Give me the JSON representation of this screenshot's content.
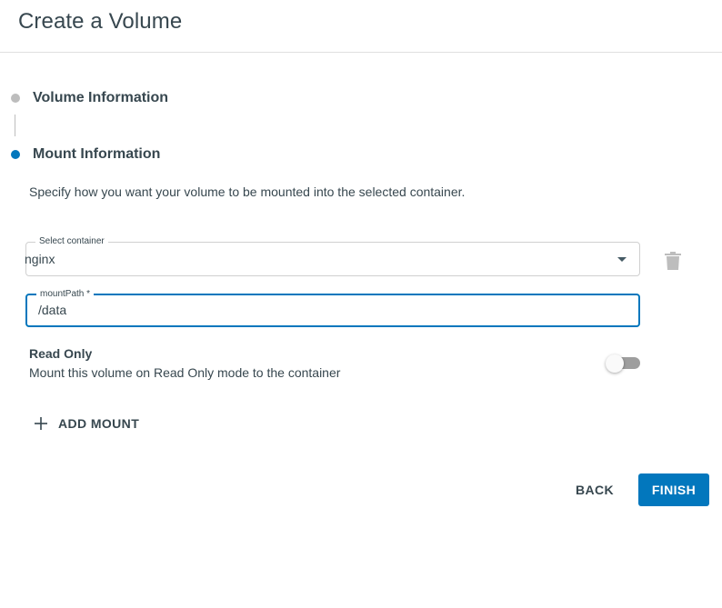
{
  "header": {
    "title": "Create a Volume"
  },
  "stepper": {
    "steps": [
      {
        "label": "Volume Information",
        "state": "completed"
      },
      {
        "label": "Mount Information",
        "state": "active"
      }
    ]
  },
  "mount": {
    "description": "Specify how you want your volume to be mounted into the selected container.",
    "container": {
      "legend": "Select container",
      "value": "nginx"
    },
    "mount_path": {
      "legend": "mountPath *",
      "value": "/data"
    },
    "read_only": {
      "title": "Read Only",
      "description": "Mount this volume on Read Only mode to the container",
      "enabled": false
    },
    "add_mount_label": "ADD MOUNT"
  },
  "actions": {
    "back_label": "BACK",
    "finish_label": "FINISH"
  },
  "icons": {
    "delete": "trash-icon",
    "dropdown": "caret-down-icon",
    "add": "plus-icon"
  },
  "colors": {
    "accent": "#0277bd",
    "text": "#37474f",
    "inactive_step": "#bdbdbd",
    "toggle_off": "#9e9e9e"
  }
}
